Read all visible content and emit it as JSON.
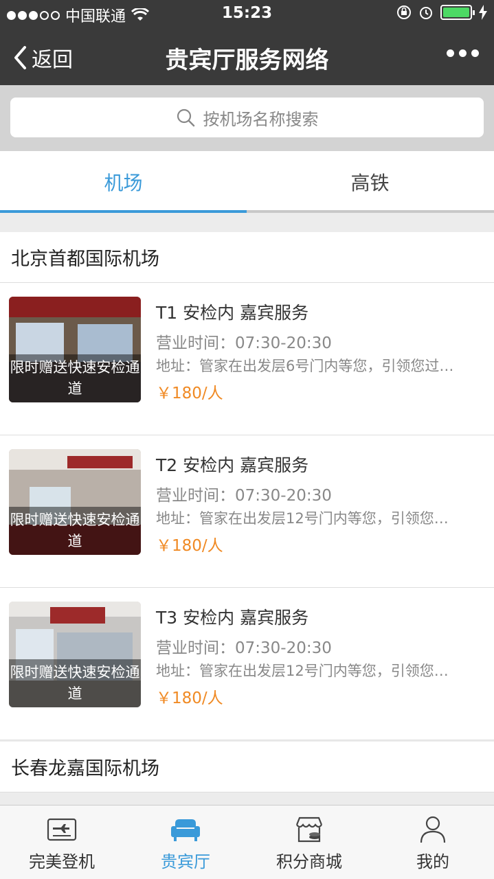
{
  "status_bar": {
    "carrier": "中国联通",
    "time": "15:23"
  },
  "nav": {
    "back_label": "返回",
    "title": "贵宾厅服务网络"
  },
  "search": {
    "placeholder": "按机场名称搜索"
  },
  "tabs": [
    {
      "label": "机场",
      "active": true
    },
    {
      "label": "高铁",
      "active": false
    }
  ],
  "sections": [
    {
      "title": "北京首都国际机场",
      "items": [
        {
          "badge": "限时赠送快速安检通道",
          "title": "T1 安检内 嘉宾服务",
          "hours": "营业时间：07:30-20:30",
          "address": "地址：管家在出发层6号门内等您，引领您过…",
          "price": "￥180/人"
        },
        {
          "badge": "限时赠送快速安检通道",
          "title": "T2 安检内 嘉宾服务",
          "hours": "营业时间：07:30-20:30",
          "address": "地址：管家在出发层12号门内等您，引领您…",
          "price": "￥180/人"
        },
        {
          "badge": "限时赠送快速安检通道",
          "title": "T3 安检内 嘉宾服务",
          "hours": "营业时间：07:30-20:30",
          "address": "地址：管家在出发层12号门内等您，引领您…",
          "price": "￥180/人"
        }
      ]
    },
    {
      "title": "长春龙嘉国际机场",
      "items": []
    }
  ],
  "tab_bar": [
    {
      "label": "完美登机",
      "icon": "boarding-pass-icon",
      "active": false
    },
    {
      "label": "贵宾厅",
      "icon": "sofa-icon",
      "active": true
    },
    {
      "label": "积分商城",
      "icon": "store-icon",
      "active": false
    },
    {
      "label": "我的",
      "icon": "user-icon",
      "active": false
    }
  ],
  "colors": {
    "accent": "#3a9ad9",
    "price": "#f08a24",
    "navbar": "#3a3a3a"
  }
}
